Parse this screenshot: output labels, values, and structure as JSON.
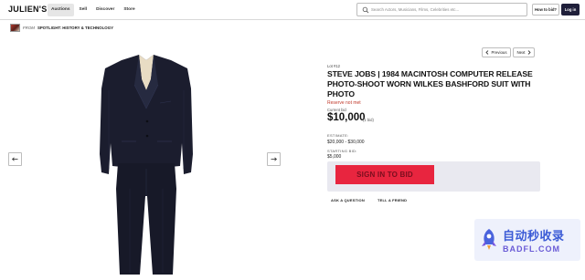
{
  "header": {
    "logo": "JULIEN'S",
    "nav": [
      {
        "label": "Auctions",
        "active": true
      },
      {
        "label": "Sell",
        "active": false
      },
      {
        "label": "Discover",
        "active": false
      },
      {
        "label": "Store",
        "active": false
      }
    ],
    "search_placeholder": "Search Actors, Musicians, Films, Celebrities etc...",
    "how_to_bid_label": "How to bid?",
    "login_label": "Log in"
  },
  "from": {
    "label": "FROM",
    "auction_name": "SPOTLIGHT: HISTORY & TECHNOLOGY"
  },
  "pager": {
    "previous_label": "Previous",
    "next_label": "Next"
  },
  "lot": {
    "number_label": "Lot #12",
    "title": "STEVE JOBS | 1984 MACINTOSH COMPUTER RELEASE PHOTO-SHOOT WORN WILKES BASHFORD SUIT WITH PHOTO",
    "reserve_status": "Reserve not met",
    "current_bid_label": "Current bid",
    "current_bid": "$10,000",
    "bid_count": "(1 bid)",
    "estimate_label": "ESTIMATE:",
    "estimate": "$20,000 - $30,000",
    "starting_bid_label": "STARTING BID:",
    "starting_bid": "$5,000",
    "sign_in_label": "SIGN IN TO BID",
    "ask_question_label": "ASK A QUESTION",
    "tell_friend_label": "TELL A FRIEND"
  },
  "watermark": {
    "chinese_text": "自动秒收录",
    "domain_text": "BADFL.COM"
  },
  "icons": {
    "search": "search-icon",
    "arrow_left": "arrow-left-icon",
    "arrow_right": "arrow-right-icon",
    "chevron_left": "chevron-left-icon",
    "chevron_right": "chevron-right-icon"
  },
  "colors": {
    "primary_dark": "#1f1f3a",
    "bid_button": "#e8253f",
    "reserve_red": "#c0392b",
    "bid_panel_bg": "#e9e9f0"
  }
}
